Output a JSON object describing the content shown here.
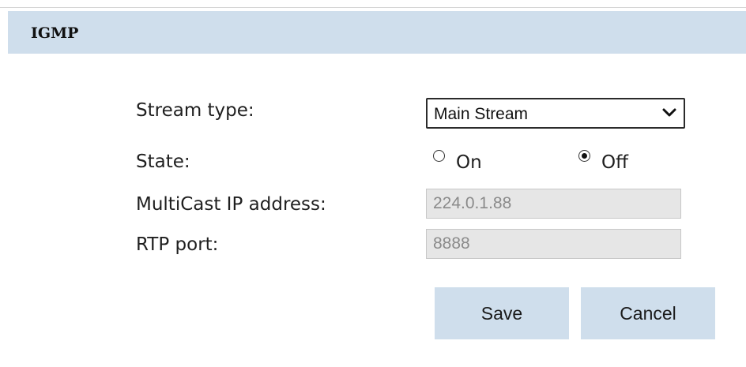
{
  "section": {
    "title": "IGMP"
  },
  "form": {
    "stream_type": {
      "label": "Stream type:",
      "value": "Main Stream"
    },
    "state": {
      "label": "State:",
      "options": [
        {
          "label": "On",
          "checked": false
        },
        {
          "label": "Off",
          "checked": true
        }
      ]
    },
    "multicast_ip": {
      "label": "MultiCast IP address:",
      "value": "224.0.1.88"
    },
    "rtp_port": {
      "label": "RTP port:",
      "value": "8888"
    }
  },
  "actions": {
    "save_label": "Save",
    "cancel_label": "Cancel"
  },
  "colors": {
    "header_bg": "#cfdeec",
    "button_bg": "#cfdeec",
    "disabled_field_bg": "#e6e6e6",
    "disabled_text": "#8a8a8a"
  },
  "icons": {
    "select_arrow": "chevron-down-icon"
  }
}
